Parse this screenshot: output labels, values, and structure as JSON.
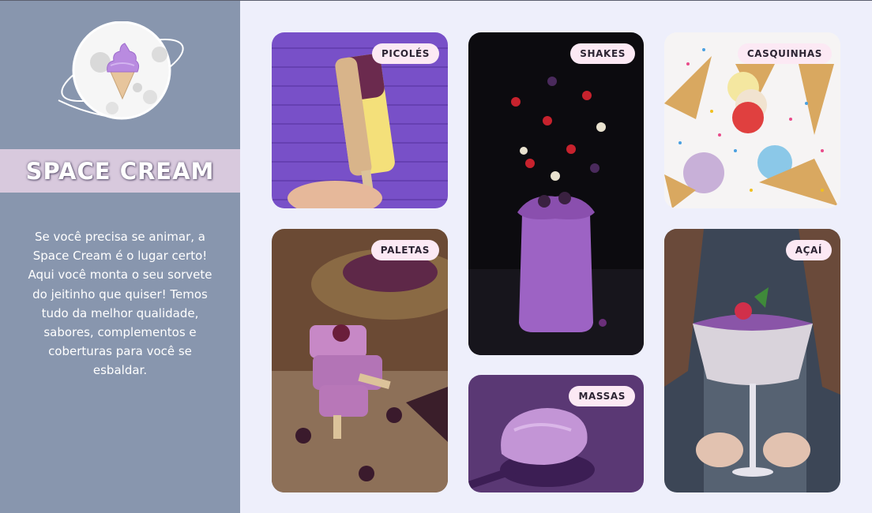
{
  "brand": {
    "name": "SPACE CREAM"
  },
  "description": "Se você precisa se animar, a Space Cream é o lugar certo! Aqui você monta o seu sorvete do jeitinho que quiser! Temos tudo da melhor qualidade, sabores, complementos e coberturas para você se esbaldar.",
  "categories": {
    "picoles": "PICOLÉS",
    "shakes": "SHAKES",
    "casquinhas": "CASQUINHAS",
    "paletas": "PALETAS",
    "acai": "AÇAÍ",
    "massas": "MASSAS"
  },
  "colors": {
    "sidebar": "#8896ae",
    "brand_band": "#d8c9dd",
    "page_background": "#eeeffb",
    "badge": "#fce9f4"
  }
}
